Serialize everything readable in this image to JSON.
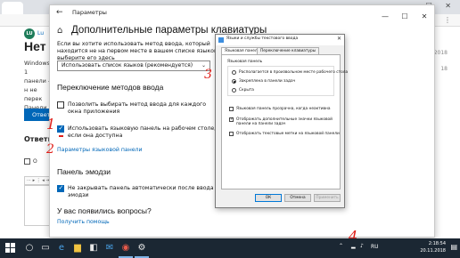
{
  "browser": {
    "tab_label": "",
    "qa_avatar": "LU",
    "qa_user": "Lu",
    "qa_title": "Нет",
    "qa_body": "Windows 1 панели - н не перек Панели у",
    "answer_button": "Ответ",
    "answer_heading": "Ответи",
    "checkbox_label": "О",
    "toolbar_text": "⋯ ▸ ⋮ ◂ ⇥",
    "date1": "2018",
    "date2": "18"
  },
  "settings": {
    "app_title": "Параметры",
    "title": "Дополнительные параметры клавиатуры",
    "desc": "Если вы хотите использовать метод ввода, который находится не на первом месте в вашем списке языков, выберите его здесь",
    "override_value": "Использовать список языков (рекомендуется)",
    "switch_heading": "Переключение методов ввода",
    "opt1_label": "Позволить выбирать метод ввода для каждого окна приложения",
    "opt1_checked": false,
    "opt2_label": "Использовать языковую панель на рабочем столе, если она доступна",
    "opt2_checked": true,
    "langbar_link": "Параметры языковой панели",
    "emoji_heading": "Панель эмодзи",
    "opt3_label": "Не закрывать панель автоматически после ввода эмодзи",
    "opt3_checked": true,
    "question_heading": "У вас появились вопросы?",
    "help_link": "Получить помощь"
  },
  "dialog": {
    "title": "Языки и службы текстового ввода",
    "tab_active": "Языковая панель",
    "tab_other": "Переключение клавиатуры",
    "group_label": "Языковая панель",
    "radio1": "Располагается в произвольном месте рабочего стола",
    "radio2": "Закреплена в панели задач",
    "radio3": "Скрыта",
    "selected_radio": 2,
    "cb1": "Языковая панель прозрачна, когда неактивна",
    "cb1_checked": false,
    "cb2": "Отображать дополнительные значки языковой панели на панели задач",
    "cb2_checked": true,
    "cb3": "Отображать текстовые метки на языковой панели",
    "cb3_checked": false,
    "ok": "ОК",
    "cancel": "Отмена",
    "apply": "Применить"
  },
  "annotations": {
    "n1": "1",
    "n2": "2",
    "n3": "3",
    "n4": "4",
    "color": "#e0201a"
  },
  "taskbar": {
    "lang": "RU",
    "time": "2:18:54",
    "date": "20.11.2018"
  }
}
